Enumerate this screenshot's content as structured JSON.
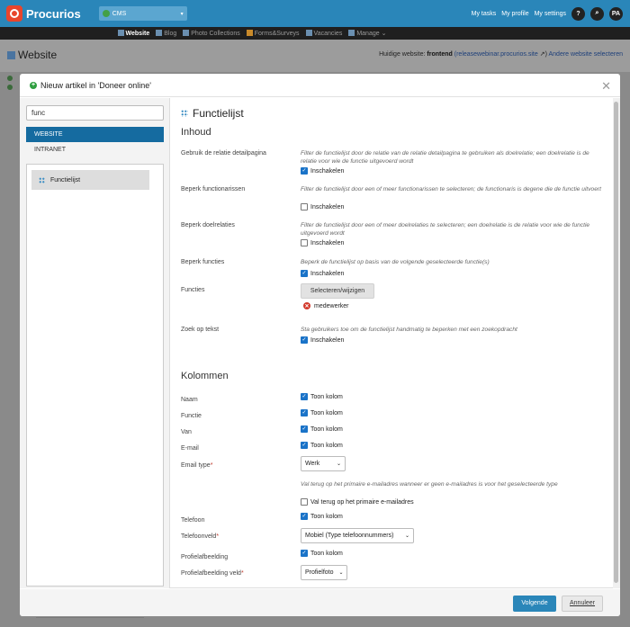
{
  "app": {
    "brand": "Procurios",
    "cms_label": "CMS"
  },
  "topnav": {
    "my_tasks": "My tasks",
    "my_profile": "My profile",
    "my_settings": "My settings",
    "help": "?",
    "user_initials": "PA"
  },
  "menu": {
    "items": [
      "Website",
      "Blog",
      "Photo Collections",
      "Forms&Surveys",
      "Vacancies",
      "Manage"
    ],
    "manage_arrow": "⌄"
  },
  "page": {
    "title": "Website",
    "current_site_label": "Huidige website:",
    "current_site_name": "frontend",
    "current_site_host": "(releasewebinar.procurios.site",
    "current_site_close": ")",
    "select_other": "Andere website selecteren"
  },
  "dialog": {
    "title": "Nieuw artikel in 'Doneer online'",
    "search_value": "func",
    "tab_website": "WEBSITE",
    "tab_intranet": "INTRANET",
    "result_tile": "Functielijst",
    "next_button": "Volgende",
    "cancel_button": "Annuleer"
  },
  "form": {
    "header": "Functielijst",
    "section_content": "Inhoud",
    "section_columns": "Kolommen",
    "relation_label": "Gebruik de relatie detailpagina",
    "relation_help": "Filter de functielijst door de relatie van de relatie detailpagina te gebruiken als doelrelatie; een doelrelatie is de relatie voor wie de functie uitgevoerd wordt",
    "relation_check": "Inschakelen",
    "officials_label": "Beperk functionarissen",
    "officials_help": "Filter de functielijst door een of meer functionarissen te selecteren; de functionaris is degene die de functie uitvoert",
    "officials_check": "Inschakelen",
    "targets_label": "Beperk doelrelaties",
    "targets_help": "Filter de functielijst door een of meer doelrelaties te selecteren; een doelrelatie is de relatie voor wie de functie uitgevoerd wordt",
    "targets_check": "Inschakelen",
    "functions_restrict_label": "Beperk functies",
    "functions_restrict_help": "Beperk de functielijst op basis van de volgende geselecteerde functie(s)",
    "functions_restrict_check": "Inschakelen",
    "functions_label": "Functies",
    "functions_button": "Selecteren/wijzigen",
    "functions_tag": "medewerker",
    "search_label": "Zoek op tekst",
    "search_help": "Sta gebruikers toe om de functielijst handmatig te beperken met een zoekopdracht",
    "search_check": "Inschakelen",
    "col_name_label": "Naam",
    "col_function_label": "Functie",
    "col_from_label": "Van",
    "col_email_label": "E-mail",
    "show_column": "Toon kolom",
    "email_type_label": "Email type",
    "email_type_value": "Werk",
    "fallback_help": "Val terug op het primaire e-mailadres wanneer er geen e-mailadres is voor het geselecteerde type",
    "fallback_check": "Val terug op het primaire e-mailadres",
    "phone_label": "Telefoon",
    "phone_field_label": "Telefoonveld",
    "phone_field_value": "Mobiel (Type telefoonnummers)",
    "picture_label": "Profielafbeelding",
    "picture_field_label": "Profielafbeelding veld",
    "picture_field_value": "Profielfoto",
    "required_mark": "*"
  },
  "colors": {
    "topbar": "#2a86b9",
    "navbar": "#1f1f1f",
    "accent": "#156ba0",
    "checkbox": "#1a73c8",
    "danger": "#d33a2c",
    "success": "#2e9e3f"
  }
}
